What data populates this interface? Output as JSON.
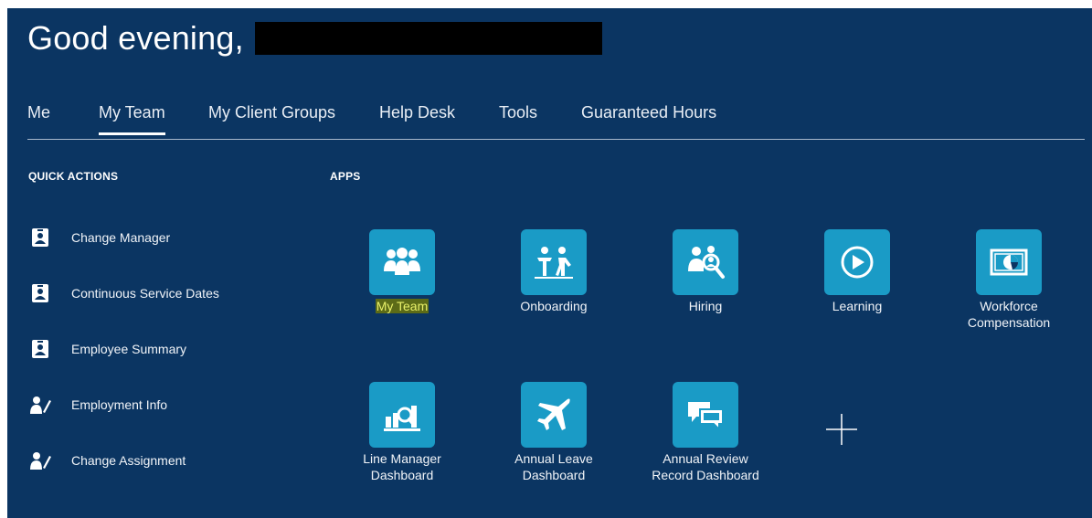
{
  "header": {
    "greeting": "Good evening,"
  },
  "tabs": [
    {
      "label": "Me"
    },
    {
      "label": "My Team",
      "active": true
    },
    {
      "label": "My Client Groups"
    },
    {
      "label": "Help Desk"
    },
    {
      "label": "Tools"
    },
    {
      "label": "Guaranteed Hours"
    }
  ],
  "quick_actions": {
    "title": "QUICK ACTIONS",
    "items": [
      {
        "label": "Change Manager",
        "icon": "badge-icon"
      },
      {
        "label": "Continuous Service Dates",
        "icon": "badge-icon"
      },
      {
        "label": "Employee Summary",
        "icon": "badge-icon"
      },
      {
        "label": "Employment Info",
        "icon": "person-edit-icon"
      },
      {
        "label": "Change Assignment",
        "icon": "person-edit-icon"
      }
    ]
  },
  "apps": {
    "title": "APPS",
    "items": [
      {
        "line1": "My Team",
        "line2": "",
        "icon": "team-icon"
      },
      {
        "line1": "Onboarding",
        "line2": "",
        "icon": "onboarding-icon"
      },
      {
        "line1": "Hiring",
        "line2": "",
        "icon": "hiring-icon"
      },
      {
        "line1": "Learning",
        "line2": "",
        "icon": "play-icon"
      },
      {
        "line1": "Workforce",
        "line2": "Compensation",
        "icon": "compensation-icon"
      },
      {
        "line1": "Line Manager",
        "line2": "Dashboard",
        "icon": "dashboard-icon"
      },
      {
        "line1": "Annual Leave",
        "line2": "Dashboard",
        "icon": "airplane-icon"
      },
      {
        "line1": "Annual Review",
        "line2": "Record Dashboard",
        "icon": "chat-icon"
      }
    ]
  },
  "colors": {
    "background": "#0b3562",
    "tile": "#1a9bc6",
    "highlight": "#e8f06a"
  }
}
